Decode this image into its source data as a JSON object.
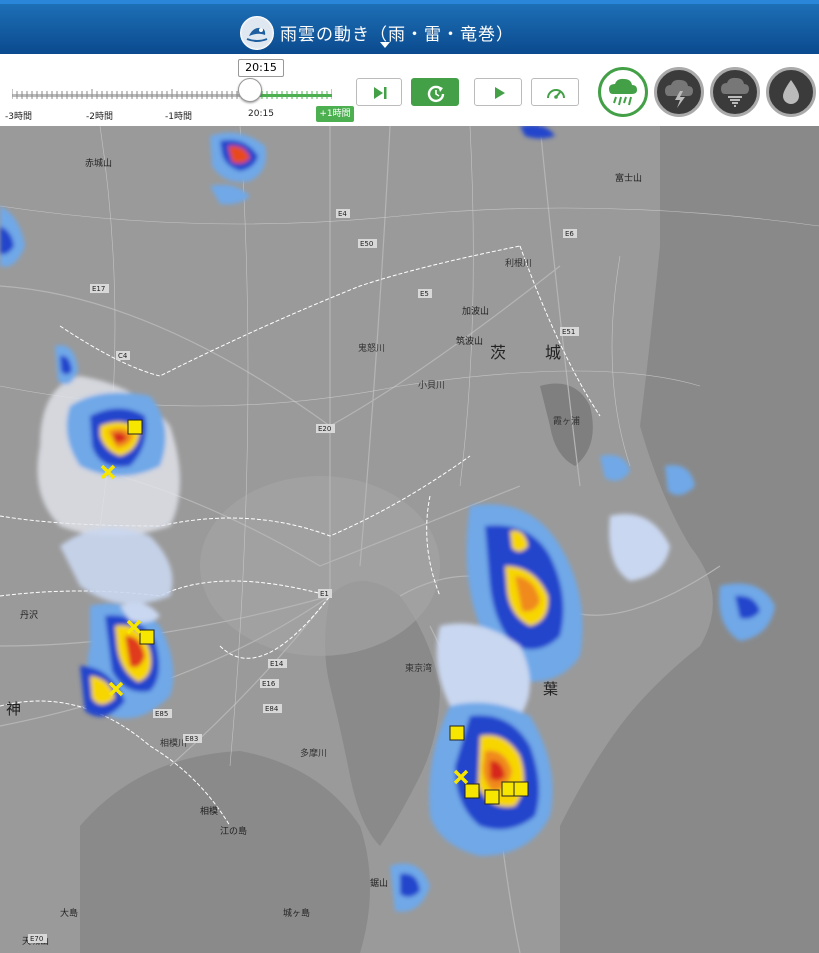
{
  "header": {
    "title": "雨雲の動き（雨・雷・竜巻）"
  },
  "timeline": {
    "current_time": "20:15",
    "labels": [
      "-3時間",
      "-2時間",
      "-1時間",
      "20:15"
    ],
    "future_label": "+1時間"
  },
  "controls": {
    "icons": [
      "skip-to-latest-icon",
      "refresh-icon",
      "play-icon",
      "speed-icon"
    ]
  },
  "modes": {
    "icons": [
      "rain-cloud-icon",
      "thunder-cloud-icon",
      "tornado-cloud-icon",
      "rain-drop-icon"
    ],
    "active": "rain-cloud-icon"
  },
  "map": {
    "place_labels": [
      {
        "text": "茨",
        "kind": "prefecture"
      },
      {
        "text": "城",
        "kind": "prefecture"
      },
      {
        "text": "葉",
        "kind": "prefecture"
      },
      {
        "text": "神",
        "kind": "prefecture"
      },
      {
        "text": "赤城山",
        "kind": "mountain"
      },
      {
        "text": "富士山",
        "kind": "mountain"
      },
      {
        "text": "筑波山",
        "kind": "mountain"
      },
      {
        "text": "加波山",
        "kind": "mountain"
      },
      {
        "text": "丹沢",
        "kind": "mountain"
      },
      {
        "text": "相模",
        "kind": "place"
      },
      {
        "text": "江の島",
        "kind": "place"
      },
      {
        "text": "城ヶ島",
        "kind": "place"
      },
      {
        "text": "天城山",
        "kind": "mountain"
      },
      {
        "text": "大島",
        "kind": "place"
      },
      {
        "text": "鋸山",
        "kind": "mountain"
      },
      {
        "text": "東京湾",
        "kind": "water"
      },
      {
        "text": "霞ヶ浦",
        "kind": "water"
      },
      {
        "text": "鬼怒川",
        "kind": "river"
      },
      {
        "text": "小貝川",
        "kind": "river"
      },
      {
        "text": "利根川",
        "kind": "river"
      },
      {
        "text": "多摩川",
        "kind": "river"
      },
      {
        "text": "相模川",
        "kind": "river"
      }
    ],
    "road_labels": [
      "E4",
      "E50",
      "E6",
      "E17",
      "E51",
      "C4",
      "E20",
      "E1",
      "E85",
      "E84",
      "E83",
      "E16",
      "E14",
      "E70",
      "E5"
    ],
    "legend_note": ""
  }
}
